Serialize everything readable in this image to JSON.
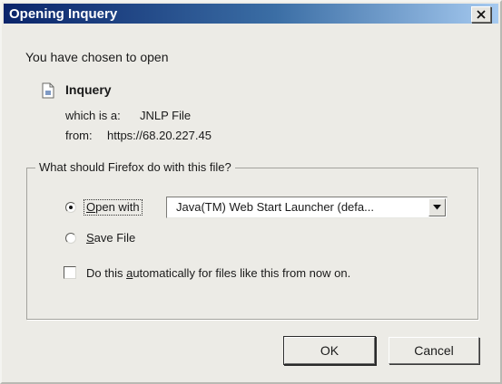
{
  "window": {
    "title": "Opening Inquery",
    "close_symbol": "×"
  },
  "dialog": {
    "intro": "You have chosen to open",
    "file": {
      "icon": "document-icon",
      "name": "Inquery",
      "kind_label": "which is a:",
      "kind_value": "JNLP File",
      "from_label": "from:",
      "from_value": "https://68.20.227.45"
    },
    "group": {
      "legend": "What should Firefox do with this file?",
      "open_with": {
        "label_access": "O",
        "label_rest": "pen with",
        "selected": true
      },
      "app_select": {
        "value": "Java(TM) Web Start Launcher (defa..."
      },
      "save_file": {
        "label_access": "S",
        "label_rest": "ave File",
        "selected": false
      },
      "auto": {
        "label_pre": "Do this ",
        "label_access": "a",
        "label_post": "utomatically for files like this from now on.",
        "checked": false
      }
    },
    "buttons": {
      "ok": "OK",
      "cancel": "Cancel"
    }
  },
  "colors": {
    "title_bar_start": "#0a246a",
    "title_bar_end": "#a6caf0",
    "dialog_background": "#ecebe6"
  }
}
